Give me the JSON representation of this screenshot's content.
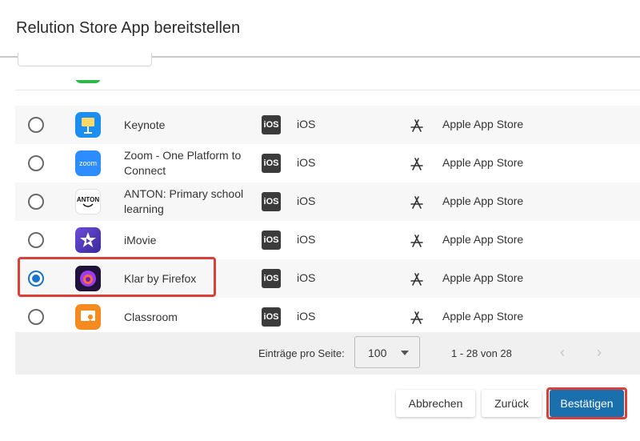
{
  "dialog": {
    "title": "Relution Store App bereitstellen"
  },
  "rows": [
    {
      "name": "Keynote",
      "platform_badge": "iOS",
      "platform": "iOS",
      "store": "Apple App Store",
      "selected": false,
      "icon": "keynote-icon"
    },
    {
      "name": "Zoom - One Platform to Connect",
      "platform_badge": "iOS",
      "platform": "iOS",
      "store": "Apple App Store",
      "selected": false,
      "icon": "zoom-icon",
      "icon_text": "zoom"
    },
    {
      "name": "ANTON: Primary school learning",
      "platform_badge": "iOS",
      "platform": "iOS",
      "store": "Apple App Store",
      "selected": false,
      "icon": "anton-icon",
      "icon_text": "ANTON"
    },
    {
      "name": "iMovie",
      "platform_badge": "iOS",
      "platform": "iOS",
      "store": "Apple App Store",
      "selected": false,
      "icon": "imovie-icon"
    },
    {
      "name": "Klar by Firefox",
      "platform_badge": "iOS",
      "platform": "iOS",
      "store": "Apple App Store",
      "selected": true,
      "icon": "firefox-klar-icon"
    },
    {
      "name": "Classroom",
      "platform_badge": "iOS",
      "platform": "iOS",
      "store": "Apple App Store",
      "selected": false,
      "icon": "classroom-icon"
    }
  ],
  "pagination": {
    "per_page_label": "Einträge pro Seite:",
    "per_page_value": "100",
    "range": "1 - 28 von 28",
    "prev_icon": "‹",
    "next_icon": "›"
  },
  "actions": {
    "cancel": "Abbrechen",
    "back": "Zurück",
    "confirm": "Bestätigen"
  },
  "colors": {
    "accent": "#1a6fad",
    "highlight": "#d9403a"
  }
}
